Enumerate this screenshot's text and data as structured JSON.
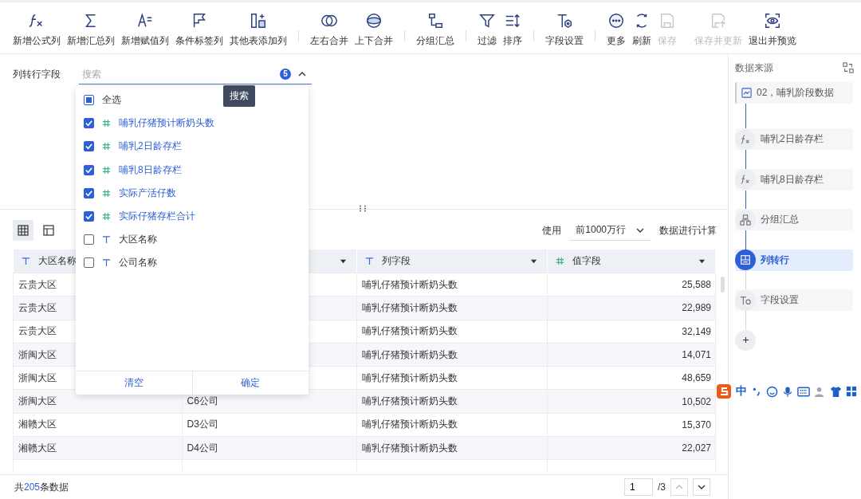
{
  "toolbar": {
    "groups": [
      [
        {
          "label": "新增公式列",
          "disabled": false
        },
        {
          "label": "新增汇总列",
          "disabled": false
        },
        {
          "label": "新增赋值列",
          "disabled": false
        },
        {
          "label": "条件标签列",
          "disabled": false
        },
        {
          "label": "其他表添加列",
          "disabled": false
        }
      ],
      [
        {
          "label": "左右合并",
          "disabled": false
        },
        {
          "label": "上下合并",
          "disabled": false
        }
      ],
      [
        {
          "label": "分组汇总",
          "disabled": false
        }
      ],
      [
        {
          "label": "过滤",
          "disabled": false
        },
        {
          "label": "排序",
          "disabled": false
        }
      ],
      [
        {
          "label": "字段设置",
          "disabled": false
        }
      ],
      [
        {
          "label": "更多",
          "disabled": false
        },
        {
          "label": "刷新",
          "disabled": false
        },
        {
          "label": "保存",
          "disabled": true
        },
        {
          "label": "保存并更新",
          "disabled": true
        },
        {
          "label": "退出并预览",
          "disabled": false
        }
      ]
    ]
  },
  "config": {
    "label": "列转行字段",
    "search": {
      "placeholder": "搜索"
    },
    "count": "5",
    "expanded": true,
    "tooltip": "搜索",
    "dropdown": {
      "select_all": {
        "label": "全选",
        "checked": false,
        "indeterminate": true
      },
      "items": [
        {
          "kind": "number",
          "label": "哺乳仔猪预计断奶头数",
          "checked": true
        },
        {
          "kind": "number",
          "label": "哺乳2日龄存栏",
          "checked": true
        },
        {
          "kind": "number",
          "label": "哺乳8日龄存栏",
          "checked": true
        },
        {
          "kind": "number",
          "label": "实际产活仔数",
          "checked": true
        },
        {
          "kind": "number",
          "label": "实际仔猪存栏合计",
          "checked": true
        },
        {
          "kind": "text",
          "label": "大区名称",
          "checked": false
        },
        {
          "kind": "text",
          "label": "公司名称",
          "checked": false
        }
      ],
      "buttons": [
        "清空",
        "确定"
      ]
    }
  },
  "view_toggle": [
    {
      "selected": true
    },
    {
      "selected": false
    }
  ],
  "calc": {
    "prefix": "使用",
    "value": "前1000万行",
    "suffix": "数据进行计算"
  },
  "table": {
    "columns": [
      {
        "kind": "text",
        "label": "大区名称"
      },
      {},
      {
        "kind": "text",
        "label": "列字段"
      },
      {
        "kind": "number",
        "label": "值字段"
      }
    ],
    "rows": [
      [
        "云贵大区",
        null,
        "哺乳仔猪预计断奶头数",
        "25,588"
      ],
      [
        "云贵大区",
        null,
        "哺乳仔猪预计断奶头数",
        "22,989"
      ],
      [
        "云贵大区",
        null,
        "哺乳仔猪预计断奶头数",
        "32,149"
      ],
      [
        "浙闽大区",
        null,
        "哺乳仔猪预计断奶头数",
        "14,071"
      ],
      [
        "浙闽大区",
        null,
        "哺乳仔猪预计断奶头数",
        "48,659"
      ],
      [
        "浙闽大区",
        "C6公司",
        "哺乳仔猪预计断奶头数",
        "10,502"
      ],
      [
        "湘赣大区",
        "D3公司",
        "哺乳仔猪预计断奶头数",
        "15,370"
      ],
      [
        "湘赣大区",
        "D4公司",
        "哺乳仔猪预计断奶头数",
        "22,027"
      ]
    ]
  },
  "footer": {
    "total_prefix": "共",
    "total": "205",
    "total_suffix": "条数据",
    "page": "1",
    "pages": "/3"
  },
  "sidebar": {
    "title": "数据来源",
    "steps": [
      {
        "kind": "source",
        "label": "02，哺乳阶段数据",
        "selected": false
      },
      {
        "kind": "formula",
        "label": "哺乳2日龄存栏",
        "selected": false
      },
      {
        "kind": "formula",
        "label": "哺乳8日龄存栏",
        "selected": false
      },
      {
        "kind": "group",
        "label": "分组汇总",
        "selected": false
      },
      {
        "kind": "pivot",
        "label": "列转行",
        "selected": true
      },
      {
        "kind": "fields",
        "label": "字段设置",
        "selected": false
      }
    ]
  },
  "ime_bar": {
    "mode": "中"
  }
}
